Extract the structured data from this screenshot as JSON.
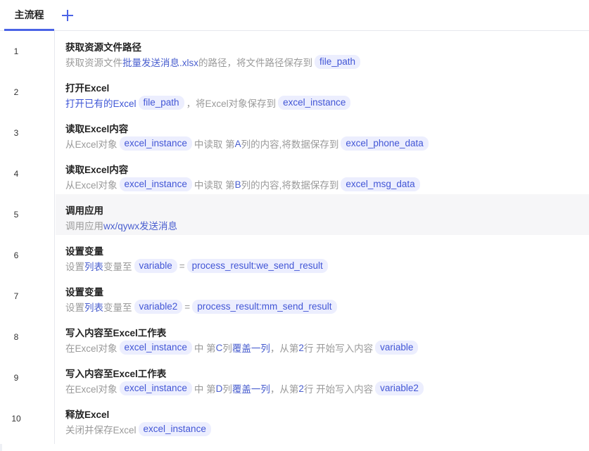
{
  "tabs": {
    "active_label": "主流程"
  },
  "colors": {
    "accent": "#4b63e6",
    "chip_bg": "#eceefe",
    "chip_text": "#4256d6",
    "muted": "#9a9a9a"
  },
  "icons": {
    "add": "plus-icon"
  },
  "steps": [
    {
      "num": "1",
      "title": "获取资源文件路径",
      "parts": [
        {
          "type": "t",
          "text": "获取资源文件 "
        },
        {
          "type": "k",
          "text": "批量发送消息.xlsx"
        },
        {
          "type": "t",
          "text": " 的路径，将文件路径保存到"
        },
        {
          "type": "chip",
          "text": "file_path"
        }
      ]
    },
    {
      "num": "2",
      "title": "打开Excel",
      "parts": [
        {
          "type": "link",
          "text": "打开已有的Excel"
        },
        {
          "type": "chip",
          "text": "file_path"
        },
        {
          "type": "t",
          "text": "，将Excel对象保存到"
        },
        {
          "type": "chip",
          "text": "excel_instance"
        }
      ]
    },
    {
      "num": "3",
      "title": "读取Excel内容",
      "parts": [
        {
          "type": "t",
          "text": "从Excel对象"
        },
        {
          "type": "chip",
          "text": "excel_instance"
        },
        {
          "type": "t",
          "text": "中读取 第 "
        },
        {
          "type": "k",
          "text": "A"
        },
        {
          "type": "t",
          "text": " 列的内容,将数据保存到"
        },
        {
          "type": "chip",
          "text": "excel_phone_data"
        }
      ]
    },
    {
      "num": "4",
      "title": "读取Excel内容",
      "parts": [
        {
          "type": "t",
          "text": "从Excel对象"
        },
        {
          "type": "chip",
          "text": "excel_instance"
        },
        {
          "type": "t",
          "text": "中读取 第 "
        },
        {
          "type": "k",
          "text": "B"
        },
        {
          "type": "t",
          "text": " 列的内容,将数据保存到"
        },
        {
          "type": "chip",
          "text": "excel_msg_data"
        }
      ]
    },
    {
      "num": "5",
      "title": "调用应用",
      "highlight": true,
      "parts": [
        {
          "type": "t",
          "text": "调用应用 "
        },
        {
          "type": "k",
          "text": "wx/qywx发送消息"
        }
      ]
    },
    {
      "num": "6",
      "title": "设置变量",
      "parts": [
        {
          "type": "t",
          "text": "设置 "
        },
        {
          "type": "k",
          "text": "列表"
        },
        {
          "type": "t",
          "text": " 变量至"
        },
        {
          "type": "chip",
          "text": "variable"
        },
        {
          "type": "t",
          "text": " = "
        },
        {
          "type": "chip",
          "text": "process_result:we_send_result"
        }
      ]
    },
    {
      "num": "7",
      "title": "设置变量",
      "parts": [
        {
          "type": "t",
          "text": "设置 "
        },
        {
          "type": "k",
          "text": "列表"
        },
        {
          "type": "t",
          "text": " 变量至"
        },
        {
          "type": "chip",
          "text": "variable2"
        },
        {
          "type": "t",
          "text": " = "
        },
        {
          "type": "chip",
          "text": "process_result:mm_send_result"
        }
      ]
    },
    {
      "num": "8",
      "title": "写入内容至Excel工作表",
      "parts": [
        {
          "type": "t",
          "text": "在Excel对象"
        },
        {
          "type": "chip",
          "text": "excel_instance"
        },
        {
          "type": "t",
          "text": "中 第 "
        },
        {
          "type": "k",
          "text": "C"
        },
        {
          "type": "t",
          "text": " 列 "
        },
        {
          "type": "k",
          "text": "覆盖一列"
        },
        {
          "type": "t",
          "text": " ，从第 "
        },
        {
          "type": "k",
          "text": "2"
        },
        {
          "type": "t",
          "text": " 行 开始写入内容"
        },
        {
          "type": "chip",
          "text": "variable"
        }
      ]
    },
    {
      "num": "9",
      "title": "写入内容至Excel工作表",
      "parts": [
        {
          "type": "t",
          "text": "在Excel对象"
        },
        {
          "type": "chip",
          "text": "excel_instance"
        },
        {
          "type": "t",
          "text": "中 第 "
        },
        {
          "type": "k",
          "text": "D"
        },
        {
          "type": "t",
          "text": " 列 "
        },
        {
          "type": "k",
          "text": "覆盖一列"
        },
        {
          "type": "t",
          "text": " ，从第 "
        },
        {
          "type": "k",
          "text": "2"
        },
        {
          "type": "t",
          "text": " 行 开始写入内容"
        },
        {
          "type": "chip",
          "text": "variable2"
        }
      ]
    },
    {
      "num": "10",
      "title": "释放Excel",
      "parts": [
        {
          "type": "t",
          "text": "关闭并保存Excel"
        },
        {
          "type": "chip",
          "text": "excel_instance"
        }
      ]
    }
  ]
}
